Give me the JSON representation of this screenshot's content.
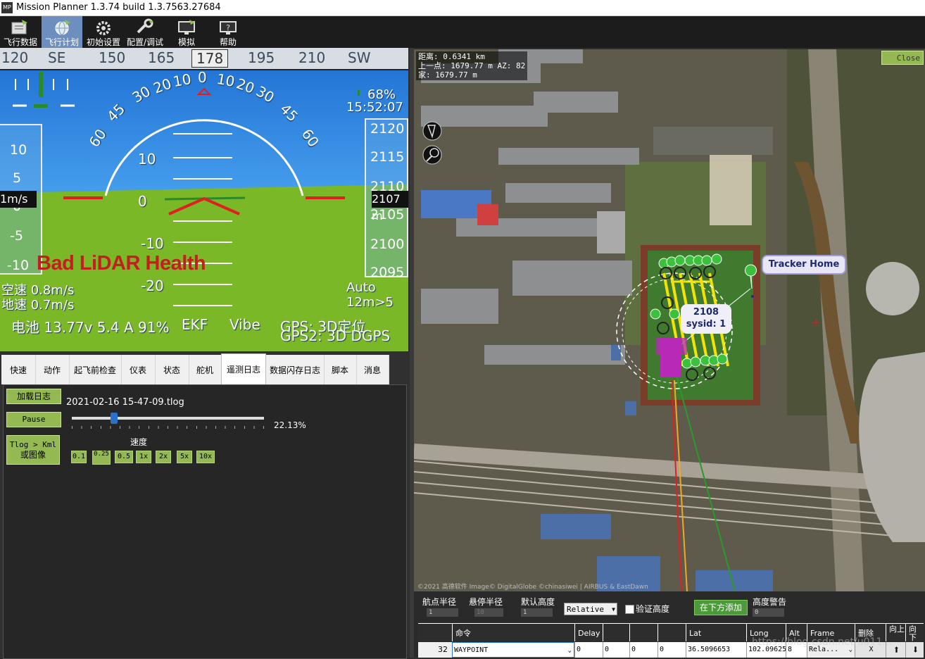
{
  "window": {
    "title": "Mission Planner 1.3.74 build 1.3.7563.27684",
    "icon_text": "MP"
  },
  "menu": [
    {
      "label": "飞行数据",
      "icon": "flight-data-icon"
    },
    {
      "label": "飞行计划",
      "icon": "flight-plan-icon",
      "active": true
    },
    {
      "label": "初始设置",
      "icon": "initial-setup-icon"
    },
    {
      "label": "配置/调试",
      "icon": "config-tuning-icon"
    },
    {
      "label": "模拟",
      "icon": "simulation-icon"
    },
    {
      "label": "帮助",
      "icon": "help-icon"
    }
  ],
  "hud": {
    "compass": {
      "ticks": [
        "120",
        "SE",
        "150",
        "165",
        "195",
        "210",
        "SW"
      ],
      "heading": "178"
    },
    "pitch_labels": [
      "10",
      "0",
      "-10",
      "-20"
    ],
    "roll_labels": [
      "60",
      "45",
      "30",
      "20",
      "10",
      "0",
      "10",
      "20",
      "30",
      "45",
      "60"
    ],
    "speed_tape": [
      "10",
      "5",
      "0",
      "-5",
      "-10"
    ],
    "speed_current": "1m/s",
    "alt_tape": [
      "2120",
      "2115",
      "2110",
      "2105",
      "2100",
      "2095"
    ],
    "alt_current": "2107 m",
    "battery_signal": "68%",
    "clock": "15:52:07",
    "warning": "Bad LiDAR Health",
    "airspeed": "空速 0.8m/s",
    "groundspeed": "地速 0.7m/s",
    "mode": "Auto",
    "wp_dist": "12m>5",
    "battery": "电池 13.77v 5.4 A 91%",
    "ekf": "EKF",
    "vibe": "Vibe",
    "gps": "GPS: 3D定位",
    "gps2": "GPS2: 3D DGPS"
  },
  "tabs": [
    "快速",
    "动作",
    "起飞前检查",
    "仪表",
    "状态",
    "舵机",
    "遥测日志",
    "数据闪存日志",
    "脚本",
    "消息"
  ],
  "active_tab": "遥测日志",
  "tlog": {
    "load_button": "加载日志",
    "filename": "2021-02-16 15-47-09.tlog",
    "pause_button": "Pause",
    "progress": 0.2213,
    "progress_text": "22.13%",
    "kml_button_line1": "Tlog > Kml",
    "kml_button_line2": "或图像",
    "speed_label": "速度",
    "speeds": [
      "0.1",
      "0.25",
      "0.5",
      "1x",
      "2x",
      "5x",
      "10x"
    ]
  },
  "map": {
    "info_distance": "距离: 0.6341 km",
    "info_prev": "上一点: 1679.77 m AZ: 82",
    "info_home": "家: 1679.77 m",
    "close_button": "Close",
    "tracker_home": "Tracker Home",
    "vehicle_alt": "2108",
    "vehicle_sysid": "sysid: 1",
    "copyright": "©2021 高德软件 Image© DigitalGlobe ©chinasiwei | AIRBUS & EastDawn"
  },
  "wp_settings": {
    "wp_radius_label": "航点半径",
    "wp_radius_value": "1",
    "loiter_radius_label": "悬停半径",
    "loiter_radius_value": "10",
    "default_alt_label": "默认高度",
    "default_alt_value": "1",
    "alt_frame": "Relative",
    "verify_height_label": "验证高度",
    "add_below_button": "在下方添加",
    "alt_warning_label": "高度警告",
    "alt_warning_value": "0"
  },
  "grid": {
    "headers": [
      "命令",
      "Delay",
      "",
      "",
      "",
      "Lat",
      "Long",
      "Alt",
      "Frame",
      "删除",
      "向上",
      "向下"
    ],
    "row": {
      "num": "32",
      "command": "WAYPOINT",
      "delay": "0",
      "p2": "0",
      "p3": "0",
      "p4": "0",
      "lat": "36.5096653",
      "long": "102.09625",
      "alt": "8",
      "frame": "Rela...",
      "delete": "X"
    }
  },
  "watermark": "https://blog.csdn.net/u011..."
}
